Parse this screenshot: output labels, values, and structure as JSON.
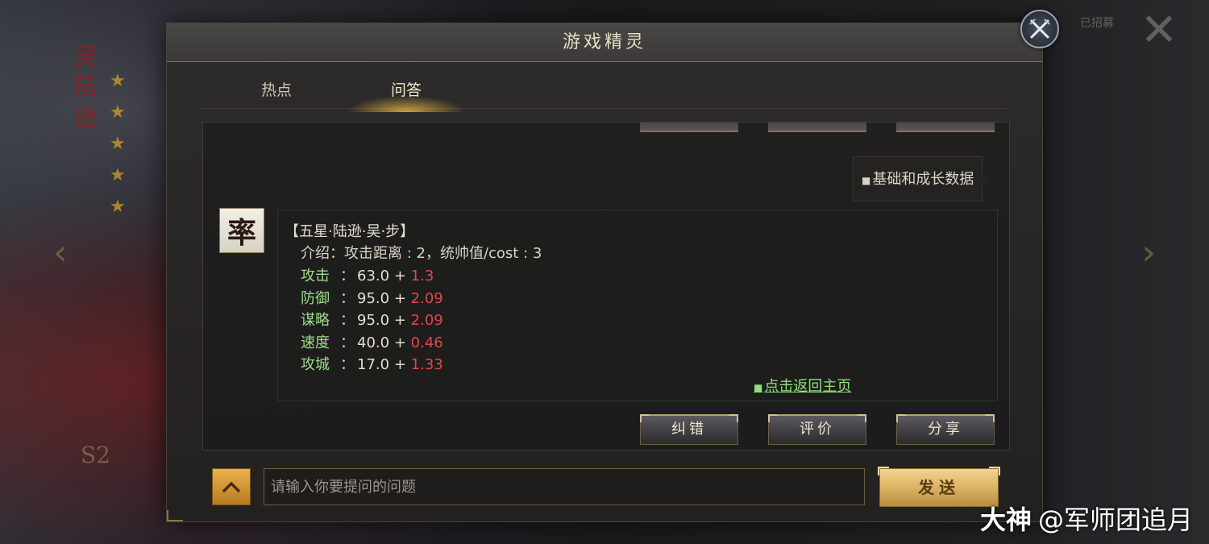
{
  "background": {
    "hero_name_vertical": "吴陆逊",
    "stars": 5,
    "season_badge": "S2",
    "topright_hint": "已招募"
  },
  "dialog": {
    "title": "游戏精灵"
  },
  "tabs": [
    {
      "label": "热点",
      "active": false
    },
    {
      "label": "问答",
      "active": true
    }
  ],
  "chip": {
    "label": "基础和成长数据"
  },
  "message": {
    "avatar_glyph": "率",
    "title": "【五星·陆逊·吴·步】",
    "intro": "介绍：攻击距离 : 2，统帅值/cost : 3",
    "stats": [
      {
        "label": "攻击",
        "colon": "：",
        "base": "63.0",
        "plus": "+",
        "growth": "1.3"
      },
      {
        "label": "防御",
        "colon": "：",
        "base": "95.0",
        "plus": "+",
        "growth": "2.09"
      },
      {
        "label": "谋略",
        "colon": "：",
        "base": "95.0",
        "plus": "+",
        "growth": "2.09"
      },
      {
        "label": "速度",
        "colon": "：",
        "base": "40.0",
        "plus": "+",
        "growth": "0.46"
      },
      {
        "label": "攻城",
        "colon": "：",
        "base": "17.0",
        "plus": "+",
        "growth": "1.33"
      }
    ],
    "back_link": "点击返回主页"
  },
  "actions": {
    "correct": "纠错",
    "rate": "评价",
    "share": "分享"
  },
  "input": {
    "placeholder": "请输入你要提问的问题",
    "value": ""
  },
  "send_label": "发送",
  "watermark": {
    "brand": "大神",
    "handle": "@军师团追月"
  },
  "colors": {
    "stat_label": "#9fdc8c",
    "stat_growth": "#e2474a",
    "link": "#8fe07a",
    "accent_gold": "#d8b060"
  }
}
